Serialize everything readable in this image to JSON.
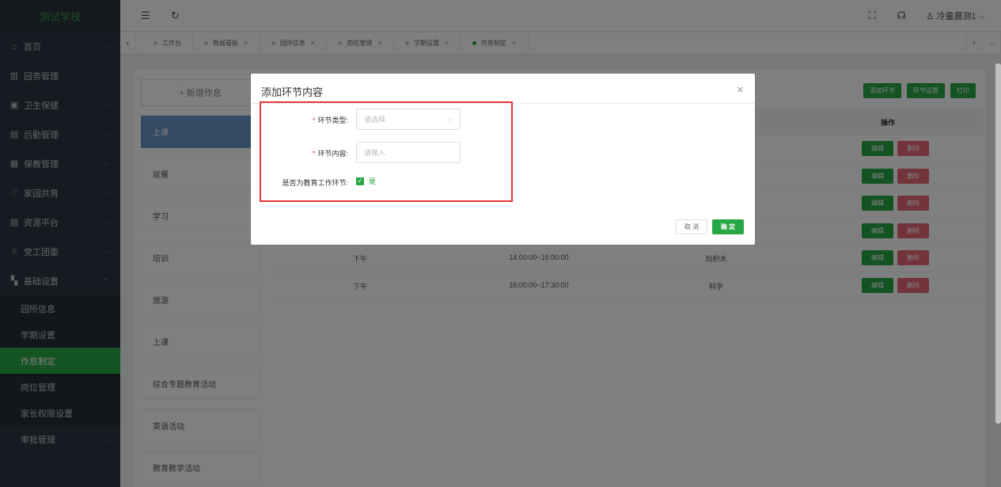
{
  "sidebar": {
    "logo": "测试学校",
    "menu": [
      {
        "label": "首页",
        "icon": "home-icon",
        "glyph": "⌂"
      },
      {
        "label": "园务管理",
        "icon": "building-icon",
        "glyph": "▥"
      },
      {
        "label": "卫生保健",
        "icon": "health-icon",
        "glyph": "▣"
      },
      {
        "label": "后勤管理",
        "icon": "logistics-icon",
        "glyph": "▤"
      },
      {
        "label": "保教管理",
        "icon": "education-icon",
        "glyph": "▦"
      },
      {
        "label": "家园共育",
        "icon": "heart-icon",
        "glyph": "♡"
      },
      {
        "label": "资源平台",
        "icon": "resource-icon",
        "glyph": "▧"
      },
      {
        "label": "党工团委",
        "icon": "star-icon",
        "glyph": "☆"
      },
      {
        "label": "基础设置",
        "icon": "grid-icon",
        "glyph": "▚"
      }
    ],
    "submenu": [
      "园所信息",
      "学期设置",
      "作息制定",
      "岗位管理",
      "家长权限设置"
    ],
    "last_item": "审批管理"
  },
  "header": {
    "user": "冷童晨测1"
  },
  "tabs": [
    {
      "label": "工作台",
      "closable": false
    },
    {
      "label": "数据看板",
      "closable": true
    },
    {
      "label": "园所信息",
      "closable": true
    },
    {
      "label": "岗位管理",
      "closable": true
    },
    {
      "label": "学期设置",
      "closable": true
    },
    {
      "label": "作息制定",
      "closable": true
    }
  ],
  "main": {
    "add_label": "+ 新增作息",
    "list": [
      "上课",
      "就餐",
      "学习",
      "培训",
      "旅游",
      "上课",
      "综合专题教育活动",
      "英语活动",
      "教育教学活动"
    ],
    "buttons": [
      "添加环节",
      "环节设置",
      "打印"
    ],
    "op_header": "操作",
    "edit_label": "编辑",
    "delete_label": "删除",
    "rows": [
      {
        "period": "",
        "time": "",
        "content": ""
      },
      {
        "period": "",
        "time": "",
        "content": ""
      },
      {
        "period": "",
        "time": "",
        "content": ""
      },
      {
        "period": "",
        "time": "",
        "content": ""
      },
      {
        "period": "下午",
        "time": "14:00:00~16:00:00",
        "content": "玩积木"
      },
      {
        "period": "下午",
        "time": "16:00:00~17:30:00",
        "content": "科学"
      }
    ]
  },
  "dialog": {
    "title": "添加环节内容",
    "type_label": "环节类型:",
    "type_placeholder": "请选择",
    "content_label": "环节内容:",
    "content_placeholder": "请输入",
    "edu_label": "是否为教育工作环节:",
    "edu_value": "是",
    "cancel": "取 消",
    "confirm": "确 定"
  },
  "colors": {
    "accent": "#28a745",
    "danger": "#dc3545",
    "sidebar": "#2f3540",
    "highlight": "#e53935"
  }
}
